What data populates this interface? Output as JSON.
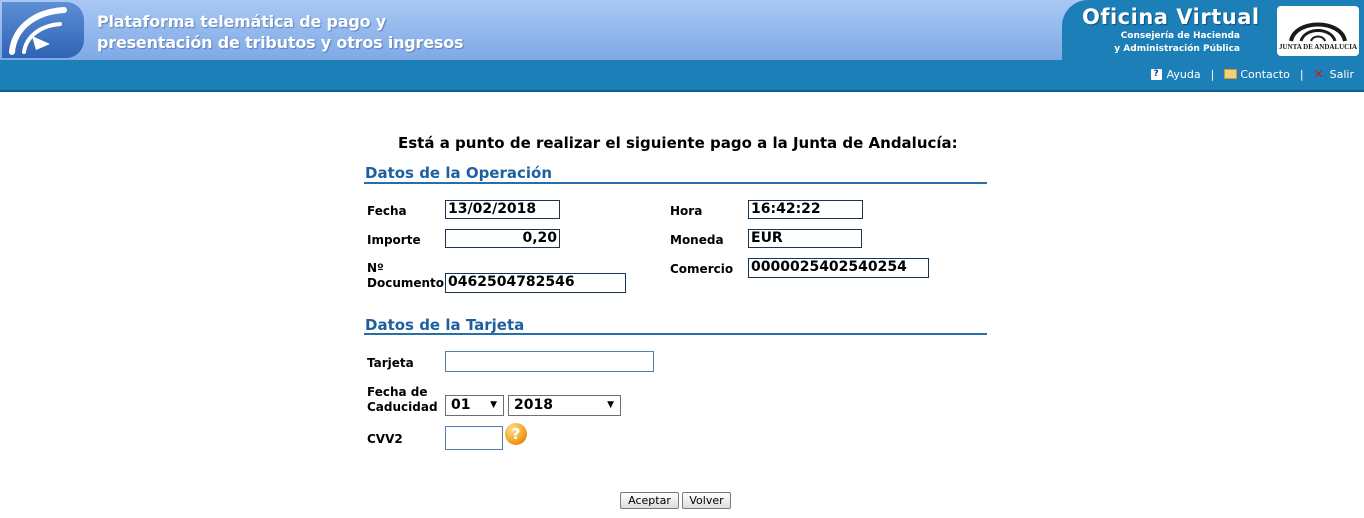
{
  "header": {
    "title_line1": "Plataforma telemática de pago y",
    "title_line2": "presentación de tributos y otros ingresos",
    "office_title": "Oficina Virtual",
    "office_sub1": "Consejería de Hacienda",
    "office_sub2": "y Administración Pública",
    "junta_logo_text": "JUNTA DE ANDALUCIA",
    "links": {
      "help": "Ayuda",
      "contact": "Contacto",
      "exit": "Salir",
      "separator": "|"
    }
  },
  "intro": "Está a punto de realizar el siguiente pago a la Junta de Andalucía:",
  "operation": {
    "title": "Datos de la Operación",
    "fecha_label": "Fecha",
    "fecha_value": "13/02/2018",
    "hora_label": "Hora",
    "hora_value": "16:42:22",
    "importe_label": "Importe",
    "importe_value": "0,20",
    "moneda_label": "Moneda",
    "moneda_value": "EUR",
    "documento_label_1": "Nº",
    "documento_label_2": "Documento",
    "documento_value": "0462504782546",
    "comercio_label": "Comercio",
    "comercio_value": "0000025402540254"
  },
  "card": {
    "title": "Datos de la Tarjeta",
    "tarjeta_label": "Tarjeta",
    "tarjeta_value": "",
    "caducidad_label_1": "Fecha de",
    "caducidad_label_2": "Caducidad",
    "month_selected": "01",
    "year_selected": "2018",
    "cvv_label": "CVV2",
    "cvv_value": "",
    "cvv_help_symbol": "?"
  },
  "buttons": {
    "accept": "Aceptar",
    "back": "Volver"
  },
  "colors": {
    "header_blue": "#1d7fb8",
    "banner_light": "#a9c8f4",
    "section_title": "#1d5f9f"
  },
  "icons": [
    "logo-swirl-icon",
    "help-icon",
    "mail-icon",
    "close-icon",
    "question-icon"
  ]
}
